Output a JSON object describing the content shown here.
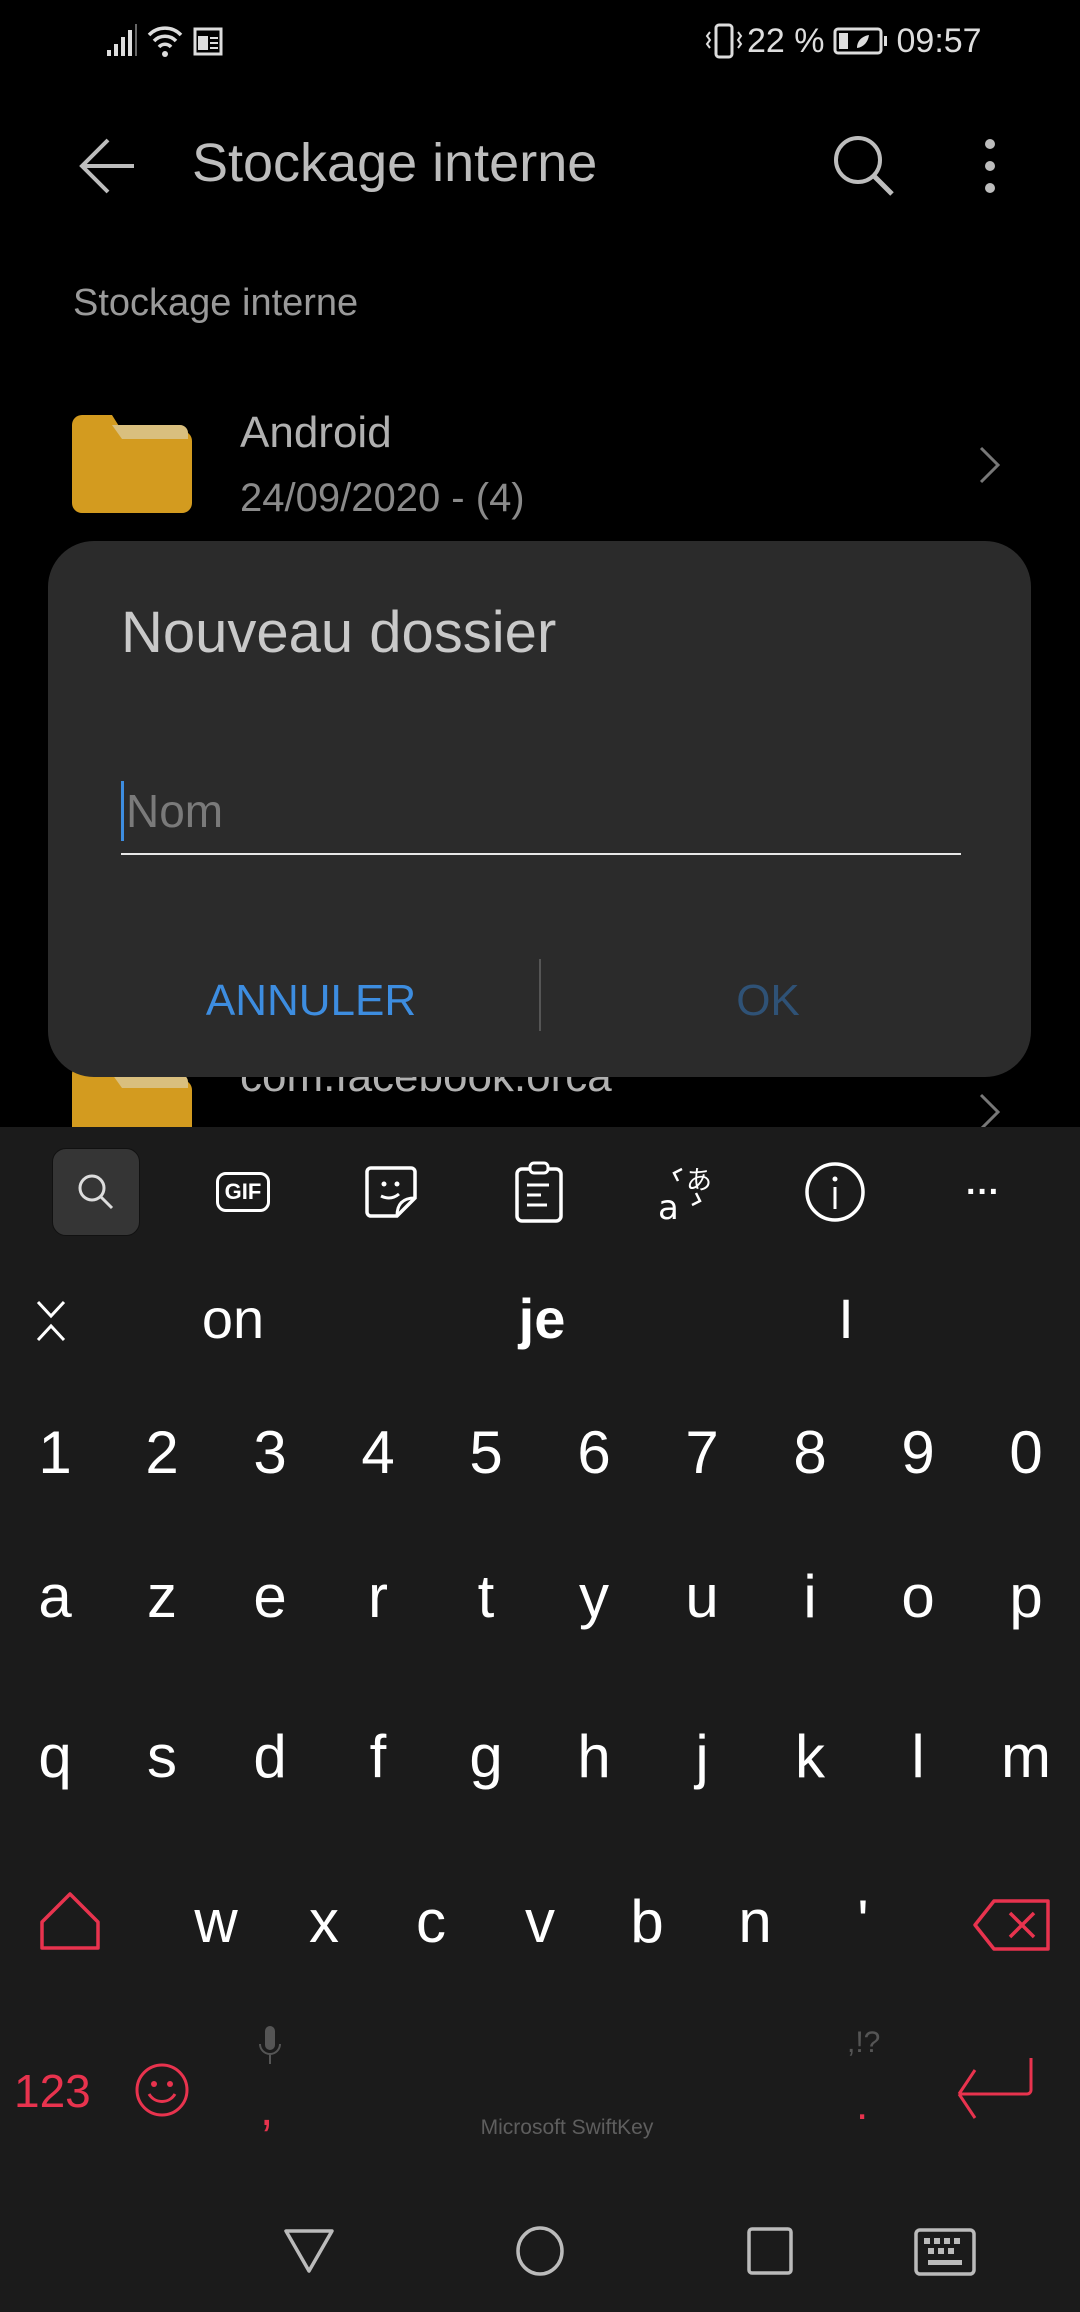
{
  "status_bar": {
    "battery": "22 %",
    "time": "09:57",
    "icons": [
      "signal-icon",
      "wifi-icon",
      "notification-icon",
      "vibrate-icon",
      "battery-saver-icon"
    ]
  },
  "toolbar": {
    "title": "Stockage interne",
    "back_icon": "arrow-left-icon",
    "search_icon": "search-icon",
    "more_icon": "more-vertical-icon"
  },
  "breadcrumb": "Stockage interne",
  "files": [
    {
      "name": "Android",
      "meta": "24/09/2020 - (4)"
    },
    {
      "name": "com.facebook.orca"
    }
  ],
  "dialog": {
    "title": "Nouveau dossier",
    "input_value": "",
    "input_placeholder": "Nom",
    "cancel": "ANNULER",
    "ok": "OK"
  },
  "keyboard": {
    "toolbar_icons": [
      "search-icon",
      "gif-icon",
      "sticker-icon",
      "clipboard-icon",
      "translate-icon",
      "info-icon",
      "more-icon"
    ],
    "gif": "GIF",
    "more": "···",
    "suggestions": [
      "on",
      "je",
      "I"
    ],
    "rows": [
      [
        "1",
        "2",
        "3",
        "4",
        "5",
        "6",
        "7",
        "8",
        "9",
        "0"
      ],
      [
        "a",
        "z",
        "e",
        "r",
        "t",
        "y",
        "u",
        "i",
        "o",
        "p"
      ],
      [
        "q",
        "s",
        "d",
        "f",
        "g",
        "h",
        "j",
        "k",
        "l",
        "m"
      ],
      [
        "w",
        "x",
        "c",
        "v",
        "b",
        "n",
        "'"
      ]
    ],
    "num_key": "123",
    "comma": ",",
    "period": ".",
    "punct_hint": ",!?",
    "space_label": "Microsoft SwiftKey",
    "accent": "#e8334e"
  },
  "colors": {
    "dialog_bg": "#2b2b2b",
    "cancel": "#3d8de0",
    "ok_disabled": "#2f5276",
    "folder": "#d39b1f"
  }
}
